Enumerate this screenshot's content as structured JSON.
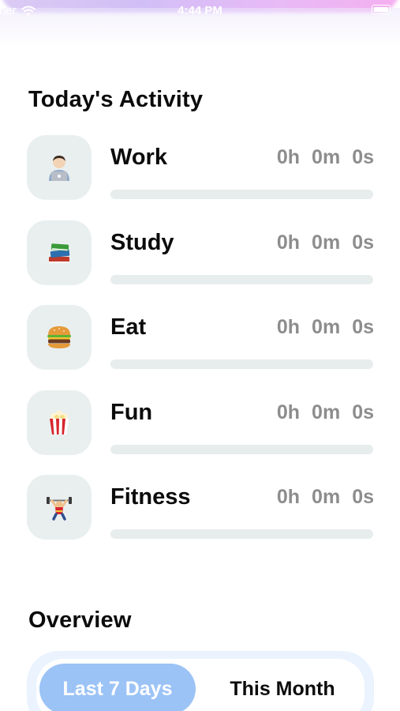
{
  "status_bar": {
    "carrier": "rrier",
    "time": "4:44 PM"
  },
  "sections": {
    "activity_title": "Today's Activity",
    "overview_title": "Overview"
  },
  "activities": [
    {
      "name": "Work",
      "icon": "technologist-icon",
      "hours": "0h",
      "minutes": "0m",
      "seconds": "0s",
      "progress": 0
    },
    {
      "name": "Study",
      "icon": "books-icon",
      "hours": "0h",
      "minutes": "0m",
      "seconds": "0s",
      "progress": 0
    },
    {
      "name": "Eat",
      "icon": "hamburger-icon",
      "hours": "0h",
      "minutes": "0m",
      "seconds": "0s",
      "progress": 0
    },
    {
      "name": "Fun",
      "icon": "popcorn-icon",
      "hours": "0h",
      "minutes": "0m",
      "seconds": "0s",
      "progress": 0
    },
    {
      "name": "Fitness",
      "icon": "weightlifter-icon",
      "hours": "0h",
      "minutes": "0m",
      "seconds": "0s",
      "progress": 0
    }
  ],
  "overview": {
    "segments": [
      "Last 7 Days",
      "This Month"
    ],
    "selected": "Last 7 Days"
  },
  "colors": {
    "accent": "#9cc3f6",
    "tile_bg": "#e9efef",
    "track_bg": "#e7eded",
    "time_text": "#8d8d8d"
  }
}
